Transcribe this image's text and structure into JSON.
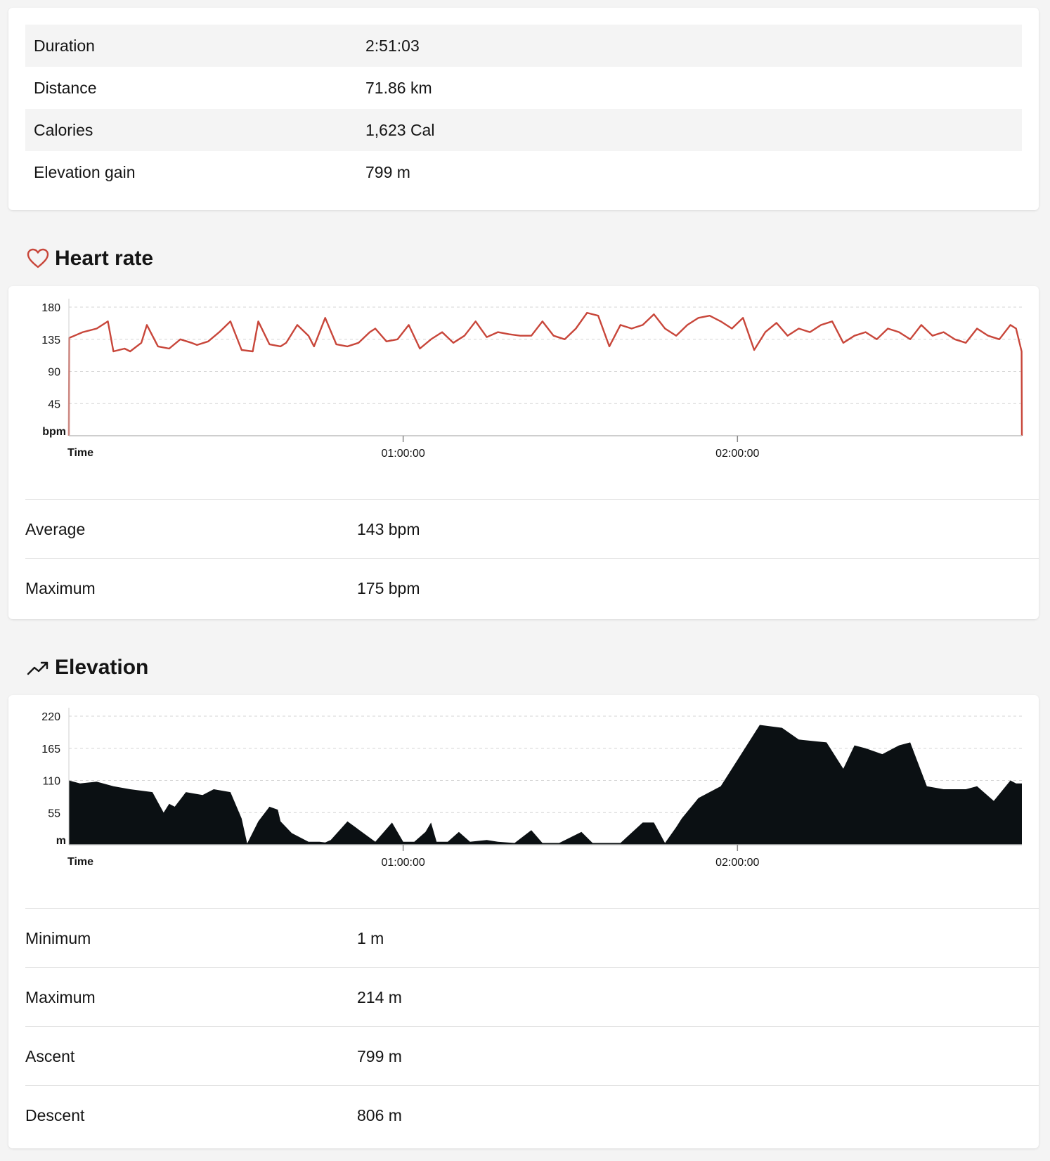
{
  "summary": [
    {
      "label": "Duration",
      "value": "2:51:03"
    },
    {
      "label": "Distance",
      "value": "71.86 km"
    },
    {
      "label": "Calories",
      "value": "1,623 Cal"
    },
    {
      "label": "Elevation gain",
      "value": "799 m"
    }
  ],
  "heart_rate": {
    "title": "Heart rate",
    "icon": "heart-icon",
    "stats": [
      {
        "label": "Average",
        "value": "143 bpm"
      },
      {
        "label": "Maximum",
        "value": "175 bpm"
      }
    ]
  },
  "elevation": {
    "title": "Elevation",
    "icon": "trending-up-icon",
    "stats": [
      {
        "label": "Minimum",
        "value": "1 m"
      },
      {
        "label": "Maximum",
        "value": "214 m"
      },
      {
        "label": "Ascent",
        "value": "799 m"
      },
      {
        "label": "Descent",
        "value": "806 m"
      }
    ]
  },
  "colors": {
    "heart_line": "#c8463a",
    "elevation_fill": "#0b1013",
    "accent": "#c8463a"
  },
  "chart_data": [
    {
      "type": "line",
      "ylabel": "bpm",
      "xlabel": "Time",
      "ylim": [
        0,
        180
      ],
      "yticks": [
        "180",
        "135",
        "90",
        "45"
      ],
      "xticks": [
        "01:00:00",
        "02:00:00"
      ],
      "xtick_seconds": [
        3600,
        7200
      ],
      "duration_seconds": 10263,
      "grid": true,
      "x": [
        0,
        3,
        60,
        150,
        300,
        420,
        480,
        600,
        660,
        780,
        840,
        960,
        1080,
        1200,
        1320,
        1380,
        1500,
        1620,
        1740,
        1860,
        1980,
        2040,
        2160,
        2280,
        2340,
        2460,
        2580,
        2640,
        2760,
        2880,
        3000,
        3120,
        3240,
        3300,
        3420,
        3540,
        3660,
        3780,
        3900,
        4020,
        4140,
        4260,
        4380,
        4500,
        4620,
        4740,
        4860,
        4980,
        5100,
        5220,
        5340,
        5460,
        5580,
        5700,
        5820,
        5940,
        6060,
        6180,
        6300,
        6420,
        6540,
        6660,
        6780,
        6900,
        7020,
        7140,
        7260,
        7380,
        7500,
        7620,
        7740,
        7860,
        7980,
        8100,
        8220,
        8340,
        8460,
        8580,
        8700,
        8820,
        8940,
        9060,
        9180,
        9300,
        9420,
        9540,
        9660,
        9780,
        9900,
        10020,
        10140,
        10200,
        10260,
        10263
      ],
      "y": [
        0,
        137,
        140,
        145,
        150,
        160,
        118,
        122,
        118,
        130,
        155,
        125,
        122,
        135,
        130,
        127,
        132,
        145,
        160,
        120,
        118,
        160,
        128,
        125,
        130,
        155,
        140,
        125,
        165,
        128,
        125,
        130,
        145,
        150,
        132,
        135,
        155,
        122,
        135,
        145,
        130,
        140,
        160,
        138,
        145,
        142,
        140,
        140,
        160,
        140,
        135,
        150,
        172,
        168,
        125,
        155,
        150,
        155,
        170,
        150,
        140,
        155,
        165,
        168,
        160,
        150,
        165,
        120,
        145,
        158,
        140,
        150,
        145,
        155,
        160,
        130,
        140,
        145,
        135,
        150,
        145,
        135,
        155,
        140,
        145,
        135,
        130,
        150,
        140,
        135,
        155,
        150,
        118,
        0
      ]
    },
    {
      "type": "area",
      "ylabel": "m",
      "xlabel": "Time",
      "ylim": [
        0,
        220
      ],
      "yticks": [
        "220",
        "165",
        "110",
        "55"
      ],
      "xticks": [
        "01:00:00",
        "02:00:00"
      ],
      "xtick_seconds": [
        3600,
        7200
      ],
      "duration_seconds": 10263,
      "grid": true,
      "x": [
        0,
        120,
        300,
        480,
        660,
        900,
        1020,
        1080,
        1140,
        1260,
        1440,
        1560,
        1740,
        1860,
        1920,
        2040,
        2160,
        2250,
        2280,
        2400,
        2580,
        2640,
        2700,
        2760,
        2820,
        3000,
        3300,
        3480,
        3600,
        3720,
        3840,
        3900,
        3960,
        4080,
        4200,
        4320,
        4500,
        4620,
        4800,
        4980,
        5100,
        5280,
        5520,
        5640,
        5880,
        5940,
        6180,
        6300,
        6420,
        6540,
        6600,
        6780,
        7020,
        7200,
        7440,
        7680,
        7860,
        8160,
        8340,
        8460,
        8580,
        8760,
        8940,
        9060,
        9240,
        9420,
        9540,
        9660,
        9780,
        9960,
        10140,
        10200,
        10263
      ],
      "y": [
        110,
        105,
        108,
        100,
        95,
        90,
        55,
        70,
        65,
        90,
        85,
        95,
        90,
        45,
        2,
        40,
        65,
        60,
        40,
        20,
        5,
        5,
        5,
        4,
        8,
        40,
        5,
        38,
        5,
        5,
        22,
        38,
        5,
        5,
        22,
        5,
        8,
        5,
        3,
        25,
        3,
        3,
        22,
        3,
        3,
        3,
        38,
        38,
        3,
        30,
        45,
        80,
        100,
        145,
        205,
        200,
        180,
        175,
        130,
        170,
        165,
        155,
        170,
        175,
        100,
        95,
        95,
        95,
        100,
        75,
        110,
        105,
        105
      ]
    }
  ]
}
